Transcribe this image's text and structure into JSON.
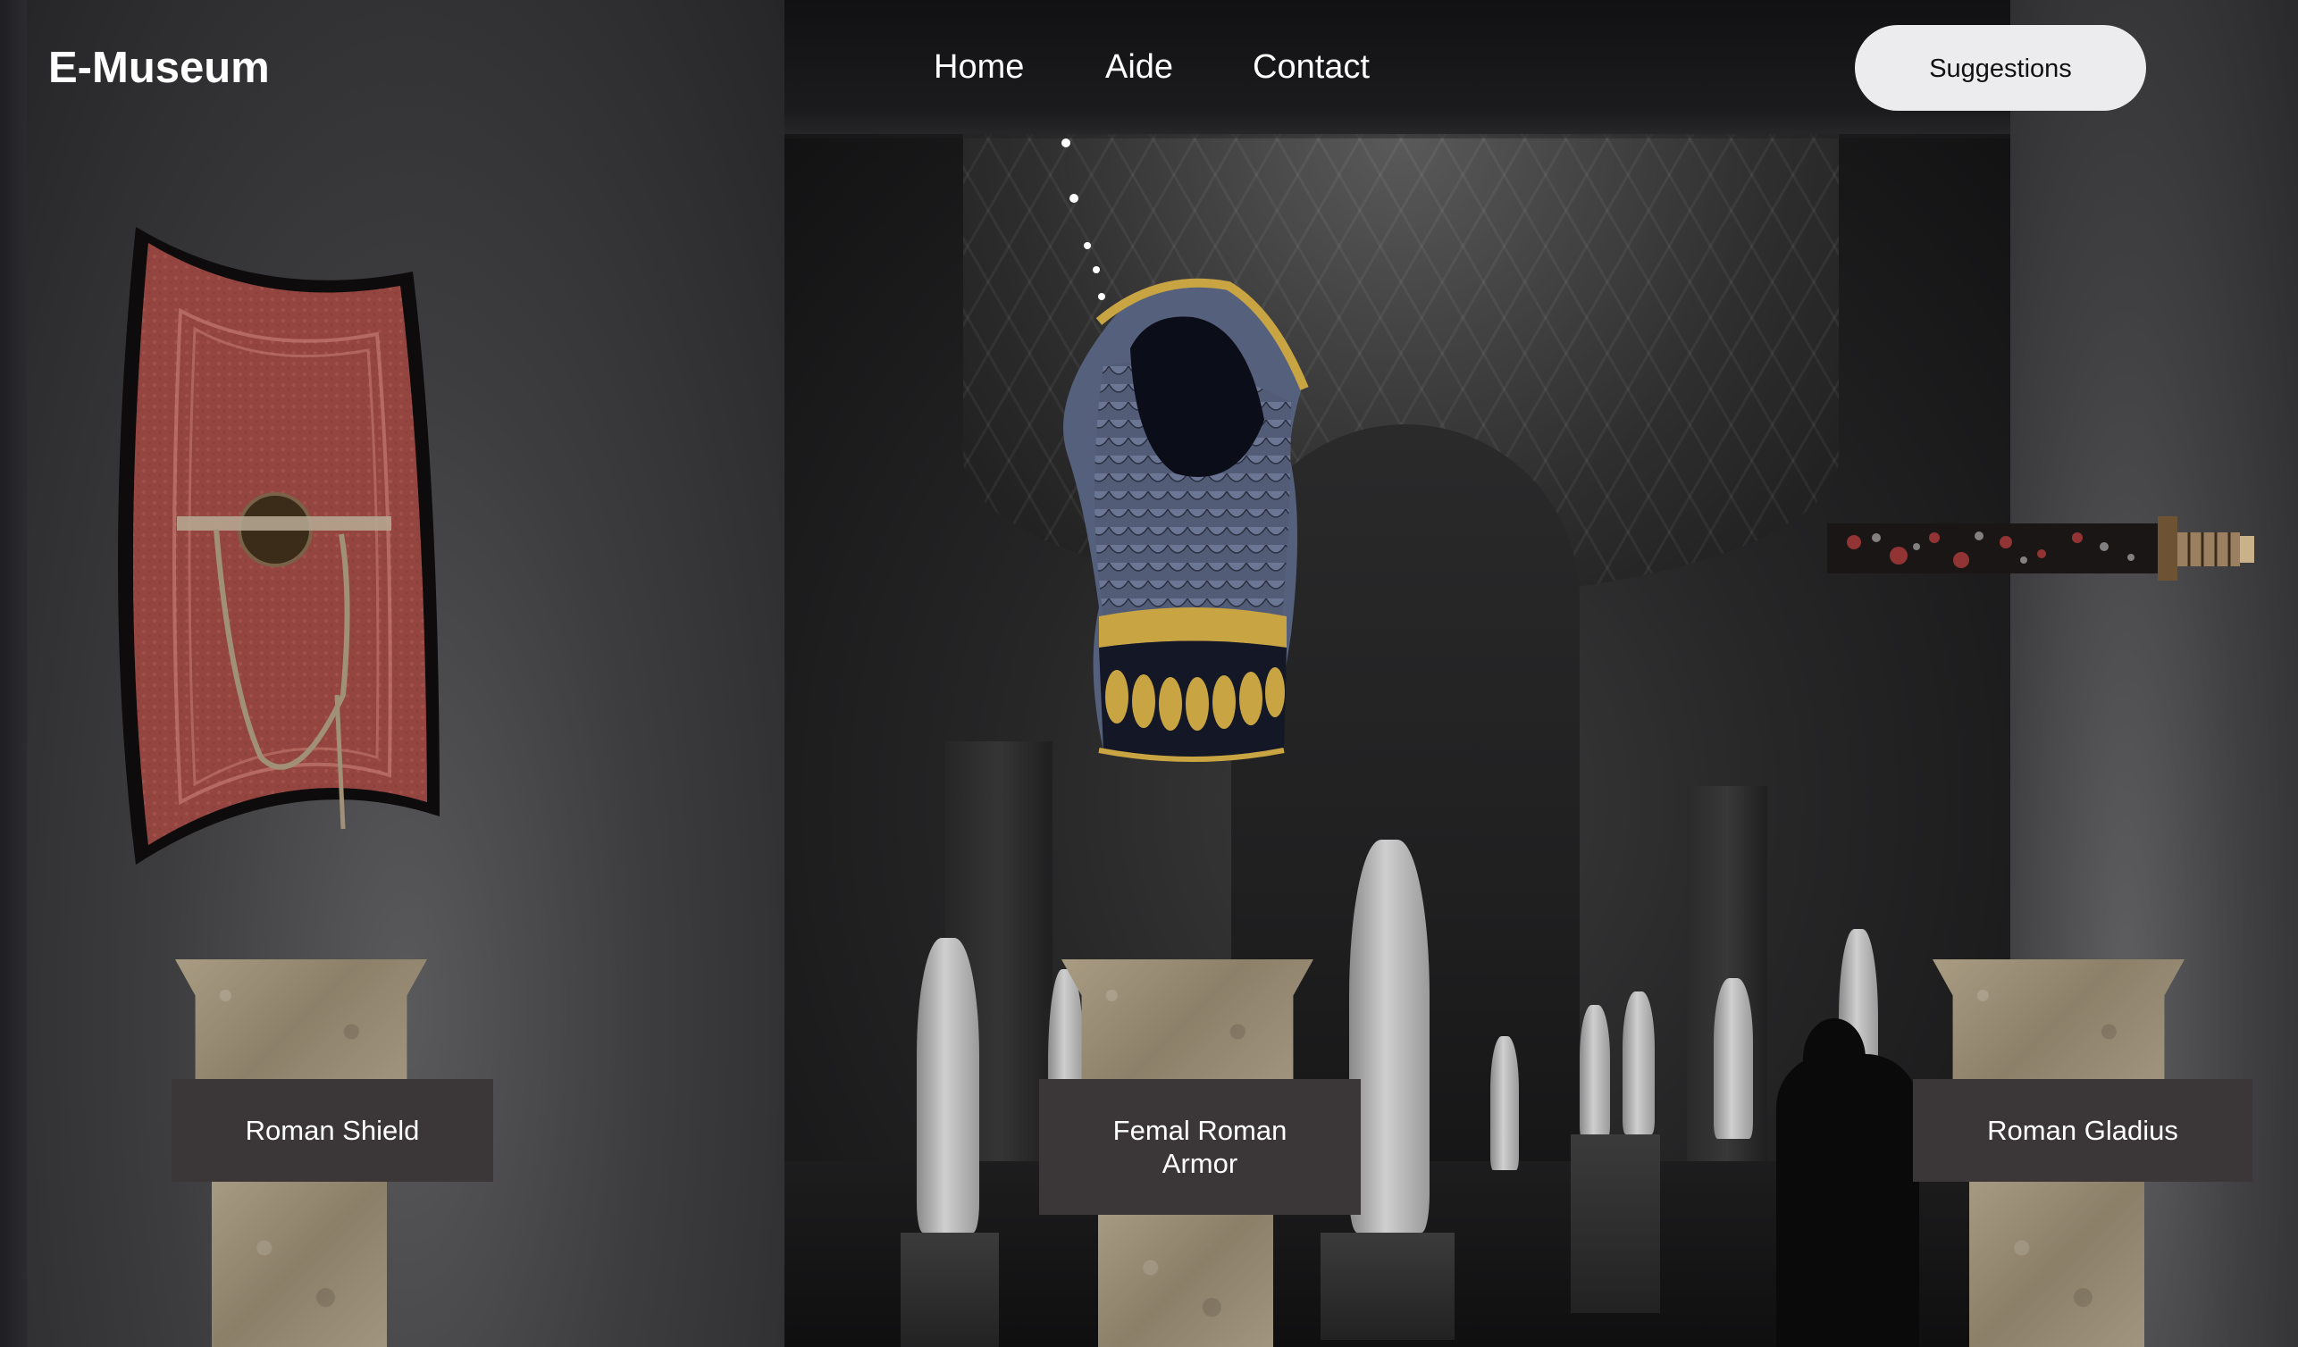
{
  "nav": {
    "brand": "E-Museum",
    "links": [
      {
        "label": "Home"
      },
      {
        "label": "Aide"
      },
      {
        "label": "Contact"
      }
    ],
    "suggestions_label": "Suggestions"
  },
  "exhibits": [
    {
      "name": "Roman Shield",
      "icon": "shield-icon"
    },
    {
      "name": "Femal Roman Armor",
      "icon": "armor-icon"
    },
    {
      "name": "Roman Gladius",
      "icon": "sword-icon"
    }
  ],
  "colors": {
    "label_bg": "#3b3738",
    "button_bg": "#ececef",
    "shield_red": "#9a4a45",
    "armor_blue": "#55607c",
    "armor_gold": "#c8a443"
  }
}
